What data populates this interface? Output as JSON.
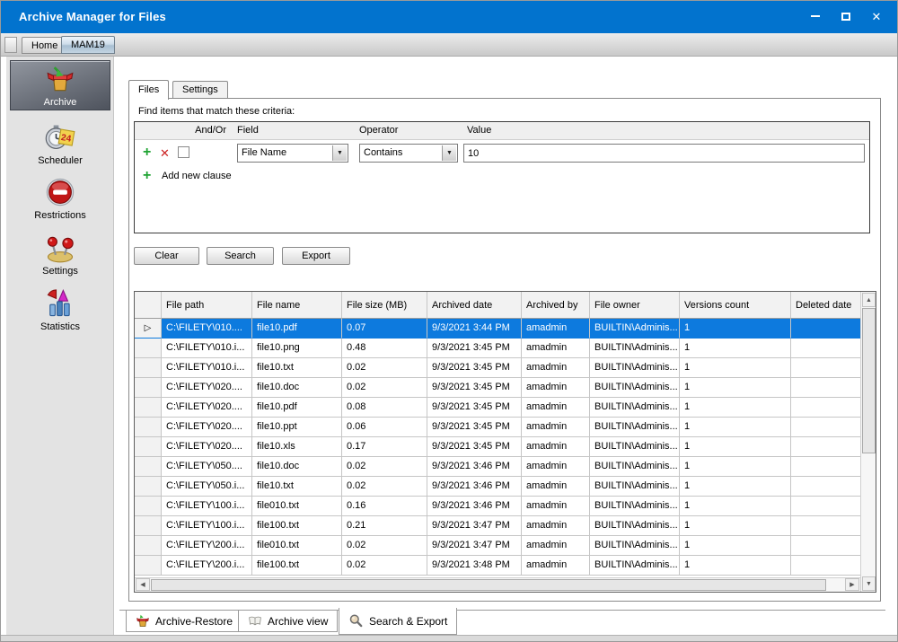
{
  "window": {
    "title": "Archive Manager for Files"
  },
  "window_controls": {
    "minimize": "minimize",
    "maximize": "maximize",
    "close": "close"
  },
  "top_tabs": [
    {
      "label": "Home",
      "selected": false
    },
    {
      "label": "MAM19",
      "selected": true
    }
  ],
  "sidebar": {
    "items": [
      {
        "label": "Archive",
        "icon": "archive-box-icon",
        "selected": true
      },
      {
        "label": "Scheduler",
        "icon": "scheduler-clock-icon",
        "selected": false
      },
      {
        "label": "Restrictions",
        "icon": "no-entry-icon",
        "selected": false
      },
      {
        "label": "Settings",
        "icon": "pushpins-icon",
        "selected": false
      },
      {
        "label": "Statistics",
        "icon": "chart-icon",
        "selected": false
      }
    ]
  },
  "inner_tabs": [
    {
      "label": "Files",
      "selected": true
    },
    {
      "label": "Settings",
      "selected": false
    }
  ],
  "criteria": {
    "caption": "Find items that match these criteria:",
    "headers": {
      "and_or": "And/Or",
      "field": "Field",
      "operator": "Operator",
      "value": "Value"
    },
    "clause": {
      "field": "File Name",
      "operator": "Contains",
      "value": "10",
      "checkbox_checked": false
    },
    "add_new_clause": "Add new clause"
  },
  "actions": {
    "clear": "Clear",
    "search": "Search",
    "export": "Export"
  },
  "grid": {
    "columns": [
      "File path",
      "File name",
      "File size (MB)",
      "Archived date",
      "Archived by",
      "File owner",
      "Versions count",
      "Deleted date"
    ],
    "selected_row_index": 0,
    "row_indicator": "▷",
    "rows": [
      [
        "C:\\FILETY\\010....",
        "file10.pdf",
        "0.07",
        "9/3/2021 3:44 PM",
        "amadmin",
        "BUILTIN\\Adminis...",
        "1",
        ""
      ],
      [
        "C:\\FILETY\\010.i...",
        "file10.png",
        "0.48",
        "9/3/2021 3:45 PM",
        "amadmin",
        "BUILTIN\\Adminis...",
        "1",
        ""
      ],
      [
        "C:\\FILETY\\010.i...",
        "file10.txt",
        "0.02",
        "9/3/2021 3:45 PM",
        "amadmin",
        "BUILTIN\\Adminis...",
        "1",
        ""
      ],
      [
        "C:\\FILETY\\020....",
        "file10.doc",
        "0.02",
        "9/3/2021 3:45 PM",
        "amadmin",
        "BUILTIN\\Adminis...",
        "1",
        ""
      ],
      [
        "C:\\FILETY\\020....",
        "file10.pdf",
        "0.08",
        "9/3/2021 3:45 PM",
        "amadmin",
        "BUILTIN\\Adminis...",
        "1",
        ""
      ],
      [
        "C:\\FILETY\\020....",
        "file10.ppt",
        "0.06",
        "9/3/2021 3:45 PM",
        "amadmin",
        "BUILTIN\\Adminis...",
        "1",
        ""
      ],
      [
        "C:\\FILETY\\020....",
        "file10.xls",
        "0.17",
        "9/3/2021 3:45 PM",
        "amadmin",
        "BUILTIN\\Adminis...",
        "1",
        ""
      ],
      [
        "C:\\FILETY\\050....",
        "file10.doc",
        "0.02",
        "9/3/2021 3:46 PM",
        "amadmin",
        "BUILTIN\\Adminis...",
        "1",
        ""
      ],
      [
        "C:\\FILETY\\050.i...",
        "file10.txt",
        "0.02",
        "9/3/2021 3:46 PM",
        "amadmin",
        "BUILTIN\\Adminis...",
        "1",
        ""
      ],
      [
        "C:\\FILETY\\100.i...",
        "file010.txt",
        "0.16",
        "9/3/2021 3:46 PM",
        "amadmin",
        "BUILTIN\\Adminis...",
        "1",
        ""
      ],
      [
        "C:\\FILETY\\100.i...",
        "file100.txt",
        "0.21",
        "9/3/2021 3:47 PM",
        "amadmin",
        "BUILTIN\\Adminis...",
        "1",
        ""
      ],
      [
        "C:\\FILETY\\200.i...",
        "file010.txt",
        "0.02",
        "9/3/2021 3:47 PM",
        "amadmin",
        "BUILTIN\\Adminis...",
        "1",
        ""
      ],
      [
        "C:\\FILETY\\200.i...",
        "file100.txt",
        "0.02",
        "9/3/2021 3:48 PM",
        "amadmin",
        "BUILTIN\\Adminis...",
        "1",
        ""
      ]
    ]
  },
  "bottom_tabs": [
    {
      "label": "Archive-Restore",
      "icon": "archive-box-icon",
      "selected": false
    },
    {
      "label": "Archive view",
      "icon": "book-icon",
      "selected": false
    },
    {
      "label": "Search & Export",
      "icon": "magnifier-icon",
      "selected": true
    }
  ],
  "colors": {
    "titlebar": "#0273ce",
    "selection": "#0d7ade",
    "sidebar_selected_top": "#91969f",
    "sidebar_selected_bottom": "#4e535d"
  }
}
